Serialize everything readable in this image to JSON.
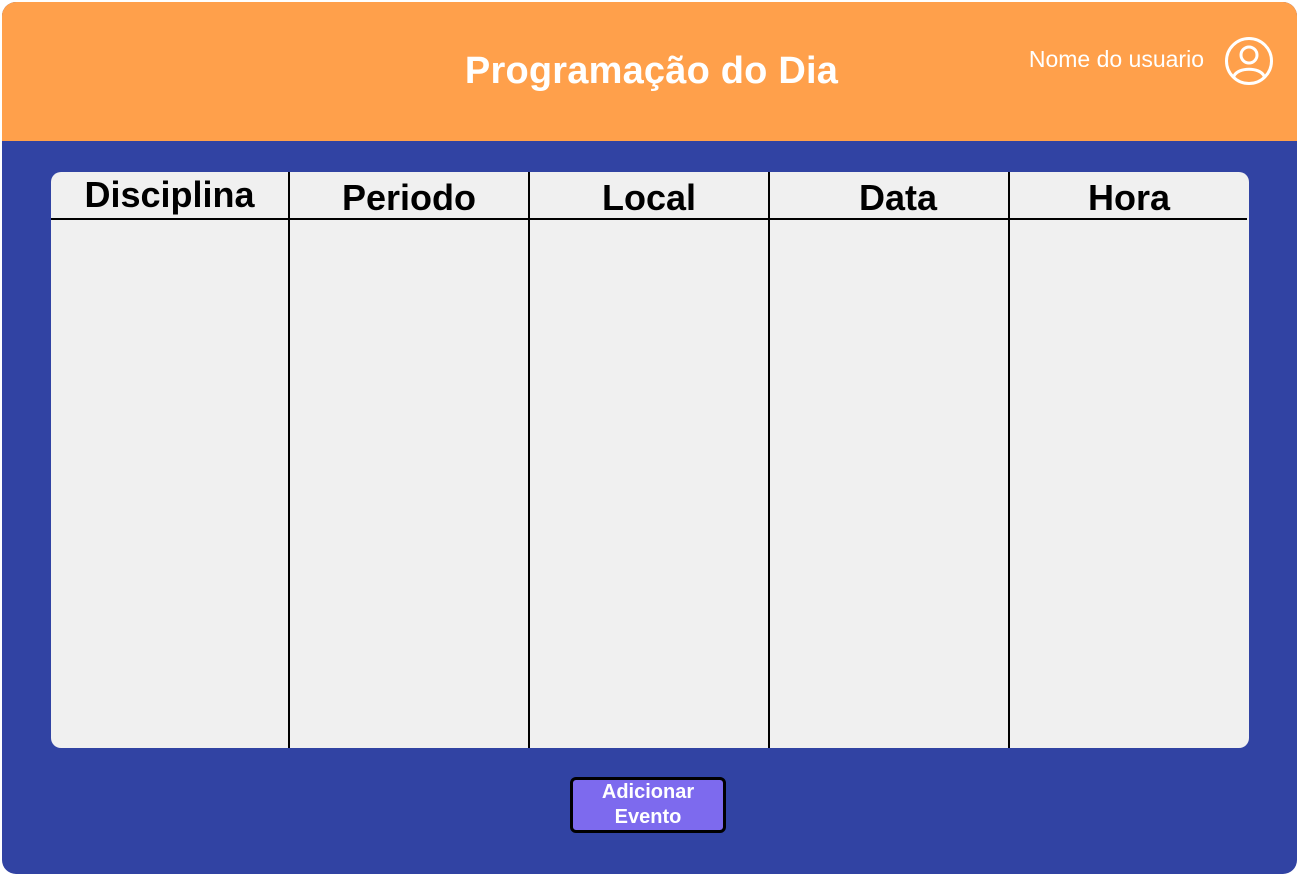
{
  "header": {
    "title": "Programação do Dia",
    "user_name": "Nome do usuario",
    "user_icon": "user-circle-icon"
  },
  "table": {
    "columns": [
      "Disciplina",
      "Periodo",
      "Local",
      "Data",
      "Hora"
    ],
    "rows": []
  },
  "actions": {
    "add_event_label": "Adicionar Evento"
  },
  "colors": {
    "header_bg": "#ffa04b",
    "body_bg": "#3143a3",
    "table_bg": "#f0f0f0",
    "button_bg": "#7d6aee"
  }
}
